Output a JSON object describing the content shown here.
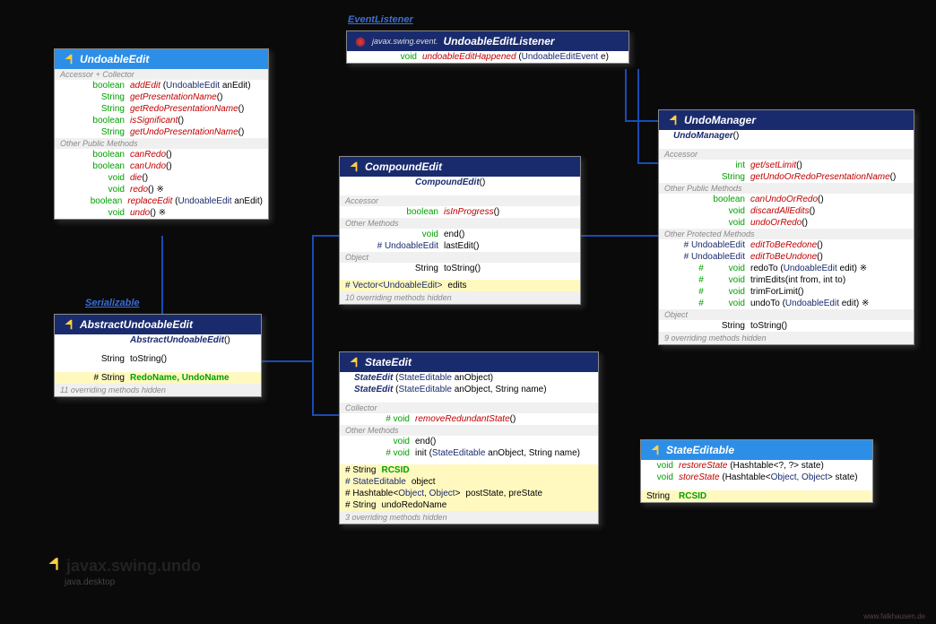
{
  "tags": {
    "serializable": "Serializable",
    "eventlistener": "EventListener"
  },
  "package": {
    "name": "javax.swing.undo",
    "module": "java.desktop"
  },
  "credit": "www.falkhausen.de",
  "undoableEdit": {
    "title": "UndoableEdit",
    "sec1": "Accessor + Collector",
    "r1_t": "boolean",
    "r1_n": "addEdit",
    "r1_p": "(UndoableEdit anEdit)",
    "r2_t": "String",
    "r2_n": "getPresentationName",
    "r2_p": "()",
    "r3_t": "String",
    "r3_n": "getRedoPresentationName",
    "r3_p": "()",
    "r4_t": "boolean",
    "r4_n": "isSignificant",
    "r4_p": "()",
    "r5_t": "String",
    "r5_n": "getUndoPresentationName",
    "r5_p": "()",
    "sec2": "Other Public Methods",
    "r6_t": "boolean",
    "r6_n": "canRedo",
    "r6_p": "()",
    "r7_t": "boolean",
    "r7_n": "canUndo",
    "r7_p": "()",
    "r8_t": "void",
    "r8_n": "die",
    "r8_p": "()",
    "r9_t": "void",
    "r9_n": "redo",
    "r9_p": "() ※",
    "r10_t": "boolean",
    "r10_n": "replaceEdit",
    "r10_p": "(UndoableEdit anEdit)",
    "r11_t": "void",
    "r11_n": "undo",
    "r11_p": "() ※"
  },
  "abstractUndoableEdit": {
    "title": "AbstractUndoableEdit",
    "r1_n": "AbstractUndoableEdit",
    "r1_p": "()",
    "r2_t": "String",
    "r2_n": "toString",
    "r2_p": "()",
    "r3_t": "# String",
    "r3_n": "RedoName, UndoName",
    "footer": "11 overriding methods hidden"
  },
  "uel": {
    "prefix": "javax.swing.event.",
    "title": "UndoableEditListener",
    "r1_t": "void",
    "r1_n": "undoableEditHappened",
    "r1_p": "(UndoableEditEvent e)"
  },
  "compoundEdit": {
    "title": "CompoundEdit",
    "r1_n": "CompoundEdit",
    "r1_p": "()",
    "sec1": "Accessor",
    "r2_t": "boolean",
    "r2_n": "isInProgress",
    "r2_p": "()",
    "sec2": "Other Methods",
    "r3_t": "void",
    "r3_n": "end",
    "r3_p": "()",
    "r4_t": "# UndoableEdit",
    "r4_n": "lastEdit",
    "r4_p": "()",
    "sec3": "Object",
    "r5_t": "String",
    "r5_n": "toString",
    "r5_p": "()",
    "r6_t": "# Vector<UndoableEdit>",
    "r6_n": "edits",
    "footer": "10 overriding methods hidden"
  },
  "stateEdit": {
    "title": "StateEdit",
    "r1_n": "StateEdit",
    "r1_p": "(StateEditable anObject)",
    "r2_n": "StateEdit",
    "r2_p": "(StateEditable anObject, String name)",
    "sec1": "Collector",
    "r3_t": "# void",
    "r3_n": "removeRedundantState",
    "r3_p": "()",
    "sec2": "Other Methods",
    "r4_t": "void",
    "r4_n": "end",
    "r4_p": "()",
    "r5_t": "# void",
    "r5_n": "init",
    "r5_p": "(StateEditable anObject, String name)",
    "r6_t": "# String",
    "r6_n": "RCSID",
    "r7_t": "# StateEditable",
    "r7_n": "object",
    "r8_t": "# Hashtable<Object, Object>",
    "r8_n": "postState, preState",
    "r9_t": "# String",
    "r9_n": "undoRedoName",
    "footer": "3 overriding methods hidden"
  },
  "undoManager": {
    "title": "UndoManager",
    "r1_n": "UndoManager",
    "r1_p": "()",
    "sec1": "Accessor",
    "r2_t": "int",
    "r2_n": "get/setLimit",
    "r2_p": "()",
    "r3_t": "String",
    "r3_n": "getUndoOrRedoPresentationName",
    "r3_p": "()",
    "sec2": "Other Public Methods",
    "r4_t": "boolean",
    "r4_n": "canUndoOrRedo",
    "r4_p": "()",
    "r5_t": "void",
    "r5_n": "discardAllEdits",
    "r5_p": "()",
    "r6_t": "void",
    "r6_n": "undoOrRedo",
    "r6_p": "()",
    "sec3": "Other Protected Methods",
    "r7_t": "# UndoableEdit",
    "r7_n": "editToBeRedone",
    "r7_p": "()",
    "r8_t": "# UndoableEdit",
    "r8_n": "editToBeUndone",
    "r8_p": "()",
    "r9_t": "#          void",
    "r9_n": "redoTo",
    "r9_p": "(UndoableEdit edit) ※",
    "r10_t": "#          void",
    "r10_n": "trimEdits",
    "r10_p": "(int from, int to)",
    "r11_t": "#          void",
    "r11_n": "trimForLimit",
    "r11_p": "()",
    "r12_t": "#          void",
    "r12_n": "undoTo",
    "r12_p": "(UndoableEdit edit) ※",
    "sec4": "Object",
    "r13_t": "String",
    "r13_n": "toString",
    "r13_p": "()",
    "footer": "9 overriding methods hidden"
  },
  "stateEditable": {
    "title": "StateEditable",
    "r1_t": "void",
    "r1_n": "restoreState",
    "r1_p": "(Hashtable<?, ?> state)",
    "r2_t": "void",
    "r2_n": "storeState",
    "r2_p": "(Hashtable<Object, Object> state)",
    "r3_t": "String",
    "r3_n": "RCSID"
  }
}
